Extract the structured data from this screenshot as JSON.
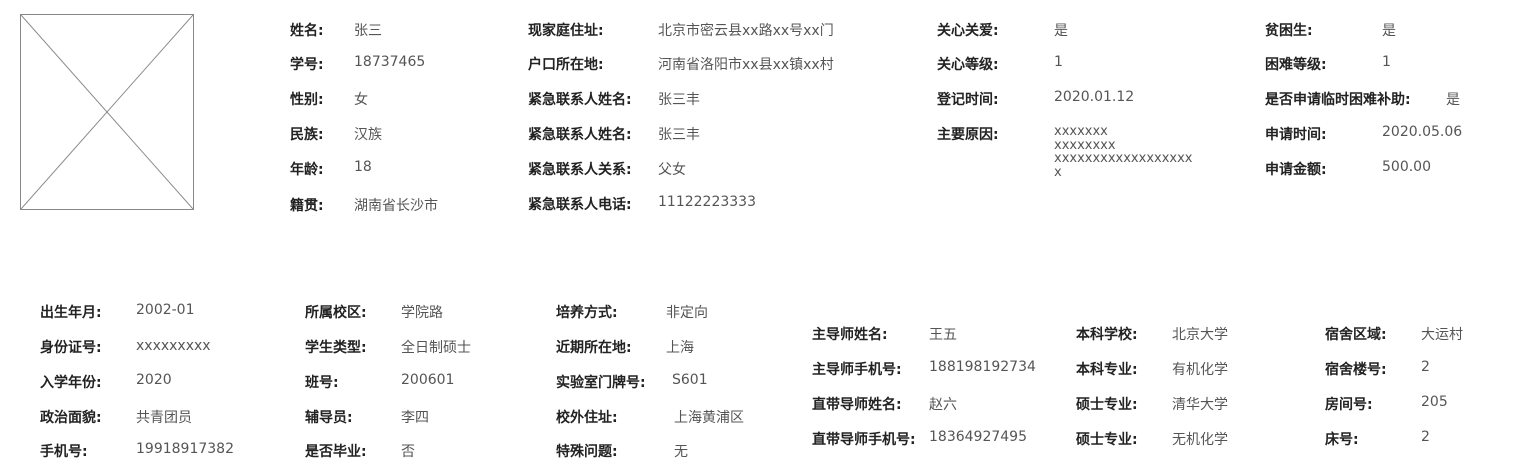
{
  "top": {
    "col1": [
      {
        "label": "姓名:",
        "value": "张三"
      },
      {
        "label": "学号:",
        "value": "18737465"
      },
      {
        "label": "性别:",
        "value": "女"
      },
      {
        "label": "民族:",
        "value": "汉族"
      },
      {
        "label": "年龄:",
        "value": "18"
      },
      {
        "label": "籍贯:",
        "value": "湖南省长沙市"
      }
    ],
    "col2": [
      {
        "label": "现家庭住址:",
        "value": "北京市密云县xx路xx号xx门"
      },
      {
        "label": "户口所在地:",
        "value": "河南省洛阳市xx县xx镇xx村"
      },
      {
        "label": "紧急联系人姓名:",
        "value": "张三丰"
      },
      {
        "label": "紧急联系人姓名:",
        "value": "张三丰"
      },
      {
        "label": "紧急联系人关系:",
        "value": "父女"
      },
      {
        "label": "紧急联系人电话:",
        "value": "11122223333"
      }
    ],
    "col3": [
      {
        "label": "关心关爱:",
        "value": "是"
      },
      {
        "label": "关心等级:",
        "value": "1"
      },
      {
        "label": "登记时间:",
        "value": "2020.01.12"
      },
      {
        "label": "主要原因:",
        "value": "xxxxxxx\nxxxxxxxx\nxxxxxxxxxxxxxxxxxx\nx"
      }
    ],
    "col4": [
      {
        "label": "贫困生:",
        "value": "是"
      },
      {
        "label": "困难等级:",
        "value": "1"
      },
      {
        "label": "是否申请临时困难补助:",
        "value": "是"
      },
      {
        "label": "申请时间:",
        "value": "2020.05.06"
      },
      {
        "label": "申请金额:",
        "value": "500.00"
      }
    ]
  },
  "bottom": {
    "col1": [
      {
        "label": "出生年月:",
        "value": "2002-01"
      },
      {
        "label": "身份证号:",
        "value": "xxxxxxxxx"
      },
      {
        "label": "入学年份:",
        "value": "2020"
      },
      {
        "label": "政治面貌:",
        "value": "共青团员"
      },
      {
        "label": "手机号:",
        "value": "19918917382"
      }
    ],
    "col2": [
      {
        "label": "所属校区:",
        "value": "学院路"
      },
      {
        "label": "学生类型:",
        "value": "全日制硕士"
      },
      {
        "label": "班号:",
        "value": "200601"
      },
      {
        "label": "辅导员:",
        "value": "李四"
      },
      {
        "label": "是否毕业:",
        "value": "否"
      }
    ],
    "col3": [
      {
        "label": "培养方式:",
        "value": "非定向"
      },
      {
        "label": "近期所在地:",
        "value": "上海"
      },
      {
        "label": "实验室门牌号:",
        "value": "S601"
      },
      {
        "label": "校外住址:",
        "value": "上海黄浦区"
      },
      {
        "label": "特殊问题:",
        "value": "无"
      }
    ],
    "col4": [
      {
        "label": "主导师姓名:",
        "value": "王五"
      },
      {
        "label": "主导师手机号:",
        "value": "188198192734"
      },
      {
        "label": "直带导师姓名:",
        "value": "赵六"
      },
      {
        "label": "直带导师手机号:",
        "value": "18364927495"
      }
    ],
    "col5": [
      {
        "label": "本科学校:",
        "value": "北京大学"
      },
      {
        "label": "本科专业:",
        "value": "有机化学"
      },
      {
        "label": "硕士专业:",
        "value": "清华大学"
      },
      {
        "label": "硕士专业:",
        "value": "无机化学"
      }
    ],
    "col6": [
      {
        "label": "宿舍区域:",
        "value": "大运村"
      },
      {
        "label": "宿舍楼号:",
        "value": "2"
      },
      {
        "label": "房间号:",
        "value": "205"
      },
      {
        "label": "床号:",
        "value": "2"
      }
    ]
  }
}
